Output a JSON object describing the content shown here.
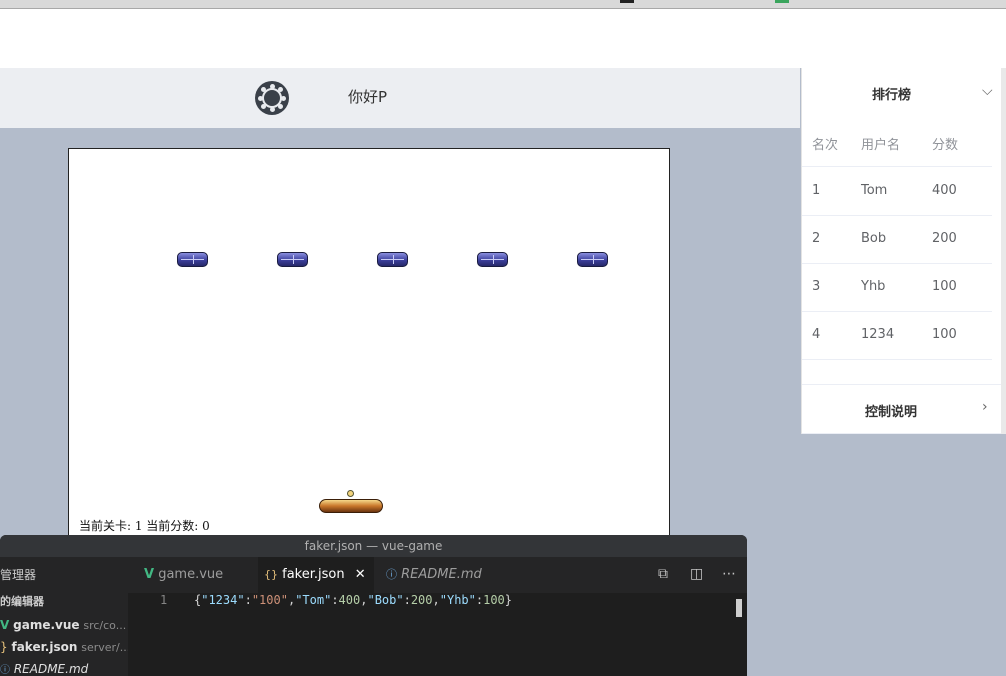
{
  "header": {
    "greeting": "你好P",
    "logo_icon": "logo-icon"
  },
  "game": {
    "status": "当前关卡: 1 当前分数: 0",
    "bricks": [
      1,
      2,
      3,
      4,
      5
    ]
  },
  "leaderboard": {
    "title": "排行榜",
    "columns": [
      "名次",
      "用户名",
      "分数"
    ],
    "rows": [
      [
        "1",
        "Tom",
        "400"
      ],
      [
        "2",
        "Bob",
        "200"
      ],
      [
        "3",
        "Yhb",
        "100"
      ],
      [
        "4",
        "1234",
        "100"
      ]
    ]
  },
  "controls": {
    "title": "控制说明"
  },
  "editor": {
    "window_title": "faker.json — vue-game",
    "sidebar": {
      "header": "管理器",
      "section": "的编辑器",
      "files": [
        {
          "icon": "V",
          "name": "game.vue",
          "path": "src/co..."
        },
        {
          "icon": "}",
          "name": "faker.json",
          "path": "server/..."
        },
        {
          "icon": "ⓘ",
          "name": "README.md",
          "path": ""
        }
      ]
    },
    "tabs": [
      {
        "icon": "V",
        "label": "game.vue",
        "active": false
      },
      {
        "icon": "{}",
        "label": "faker.json",
        "active": true
      },
      {
        "icon": "ⓘ",
        "label": "README.md",
        "active": false
      }
    ],
    "line_number": "1",
    "code_tokens": [
      "{",
      "\"1234\"",
      ":",
      "\"100\"",
      ",",
      "\"Tom\"",
      ":",
      "400",
      ",",
      "\"Bob\"",
      ":",
      "200",
      ",",
      "\"Yhb\"",
      ":",
      "100",
      "}"
    ]
  },
  "colors": {
    "page_bg": "#b3bccb",
    "accent_vue": "#42b883",
    "json_icon": "#e5c07b"
  }
}
